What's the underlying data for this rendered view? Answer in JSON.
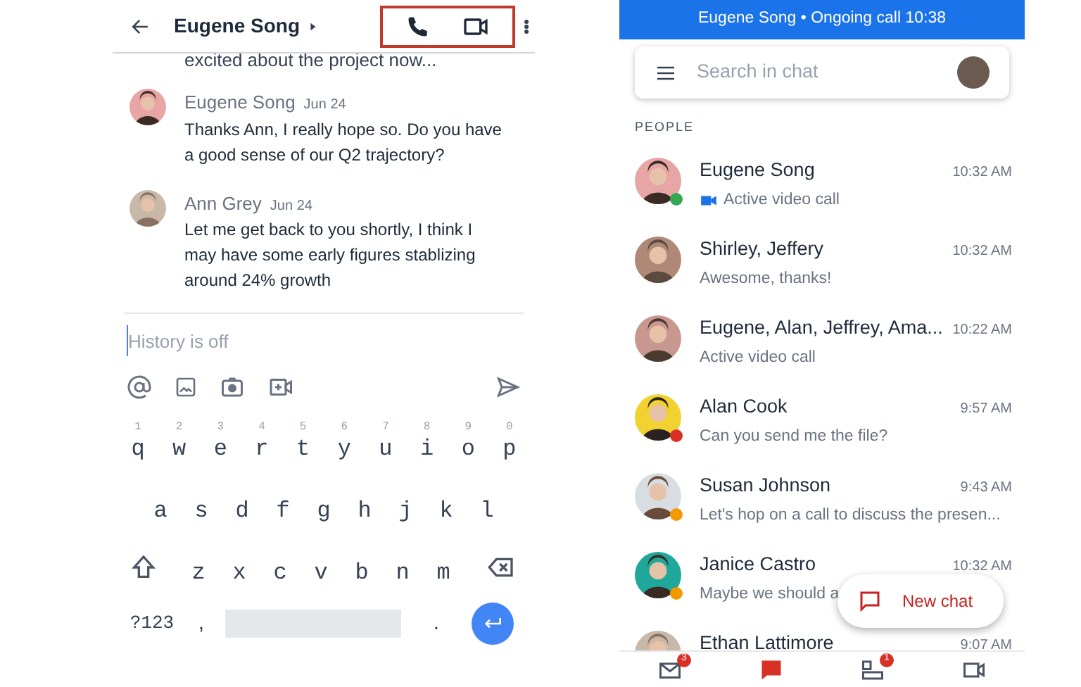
{
  "chat": {
    "title": "Eugene Song",
    "cut_message": "excited about the project now...",
    "messages": [
      {
        "author": "Eugene Song",
        "date": "Jun 24",
        "text": "Thanks Ann, I really hope so. Do you have a good sense of our Q2 trajectory?"
      },
      {
        "author": "Ann Grey",
        "date": "Jun 24",
        "text": "Let me get back to you shortly, I think I may have some early figures stablizing around 24% growth"
      }
    ],
    "compose": {
      "placeholder": "History is off"
    }
  },
  "keyboard": {
    "rows": [
      [
        {
          "key": "q",
          "hint": "1"
        },
        {
          "key": "w",
          "hint": "2"
        },
        {
          "key": "e",
          "hint": "3"
        },
        {
          "key": "r",
          "hint": "4"
        },
        {
          "key": "t",
          "hint": "5"
        },
        {
          "key": "y",
          "hint": "6"
        },
        {
          "key": "u",
          "hint": "7"
        },
        {
          "key": "i",
          "hint": "8"
        },
        {
          "key": "o",
          "hint": "9"
        },
        {
          "key": "p",
          "hint": "0"
        }
      ],
      [
        {
          "key": "a"
        },
        {
          "key": "s"
        },
        {
          "key": "d"
        },
        {
          "key": "f"
        },
        {
          "key": "g"
        },
        {
          "key": "h"
        },
        {
          "key": "j"
        },
        {
          "key": "k"
        },
        {
          "key": "l"
        }
      ],
      [
        {
          "key": "z"
        },
        {
          "key": "x"
        },
        {
          "key": "c"
        },
        {
          "key": "v"
        },
        {
          "key": "b"
        },
        {
          "key": "n"
        },
        {
          "key": "m"
        }
      ]
    ],
    "symbols_key": "?123",
    "comma_key": ",",
    "period_key": "."
  },
  "banner": "Eugene Song • Ongoing call 10:38",
  "search": {
    "placeholder": "Search in chat"
  },
  "section": "PEOPLE",
  "people": [
    {
      "name": "Eugene Song",
      "time": "10:32 AM",
      "preview": "Active video call",
      "video": true,
      "color": "#34a853"
    },
    {
      "name": "Shirley, Jeffery",
      "time": "10:32 AM",
      "preview": "Awesome, thanks!",
      "video": false
    },
    {
      "name": "Eugene, Alan, Jeffrey, Ama...",
      "time": "10:22 AM",
      "preview": "Active video call",
      "video": false
    },
    {
      "name": "Alan Cook",
      "time": "9:57 AM",
      "preview": "Can you send me the file?",
      "video": false,
      "color": "#d93025"
    },
    {
      "name": "Susan Johnson",
      "time": "9:43 AM",
      "preview": "Let's hop on a call to discuss the presen...",
      "video": false,
      "color": "#f29900"
    },
    {
      "name": "Janice Castro",
      "time": "10:32 AM",
      "preview": "Maybe we should a",
      "video": false,
      "color": "#f29900"
    },
    {
      "name": "Ethan Lattimore",
      "time": "9:07 AM"
    }
  ],
  "fab": {
    "label": "New chat"
  },
  "nav": [
    {
      "kind": "mail",
      "badge": "3",
      "selected": false
    },
    {
      "kind": "chat",
      "selected": true
    },
    {
      "kind": "rooms",
      "badge": "1",
      "selected": false
    },
    {
      "kind": "video",
      "selected": false
    }
  ]
}
